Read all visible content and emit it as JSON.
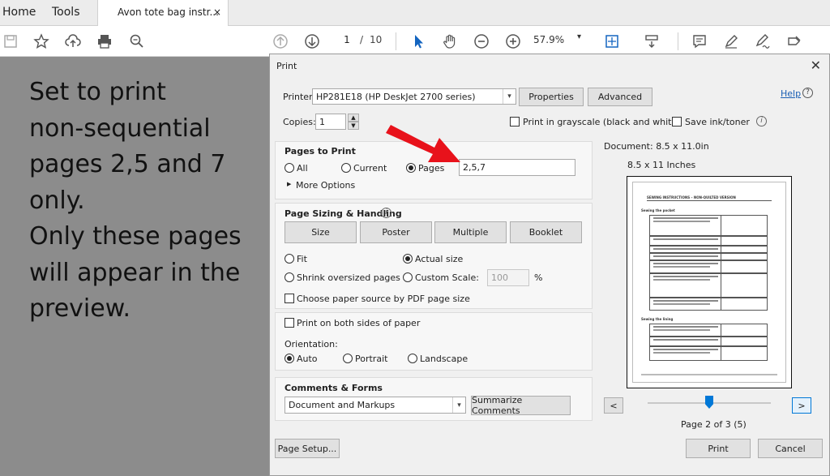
{
  "tabbar": {
    "home": "Home",
    "tools": "Tools",
    "tab_title": "Avon tote bag instr...",
    "tab_close": "×"
  },
  "toolbar": {
    "page_current": "1",
    "page_sep": "/",
    "page_total": "10",
    "zoom": "57.9%",
    "zoom_caret": "▾"
  },
  "annotation": {
    "lines": [
      "Set to print",
      "non-sequential",
      "pages 2,5 and 7",
      "only.",
      "Only these pages",
      "will appear in the",
      "preview."
    ]
  },
  "dialog": {
    "title": "Print",
    "close": "✕",
    "printer_label": "Printer:",
    "printer_value": "HP281E18 (HP DeskJet 2700 series)",
    "properties": "Properties",
    "advanced": "Advanced",
    "help": "Help",
    "help_q": "?",
    "copies_label": "Copies:",
    "copies_value": "1",
    "grayscale": "Print in grayscale (black and white)",
    "save_ink": "Save ink/toner",
    "info_i": "i",
    "pages": {
      "title": "Pages to Print",
      "all": "All",
      "current": "Current",
      "pages": "Pages",
      "pages_value": "2,5,7",
      "more_options": "More Options",
      "more_caret": "▶"
    },
    "sizing": {
      "title": "Page Sizing & Handling",
      "size": "Size",
      "poster": "Poster",
      "multiple": "Multiple",
      "booklet": "Booklet",
      "fit": "Fit",
      "actual_size": "Actual size",
      "shrink": "Shrink oversized pages",
      "custom_scale": "Custom Scale:",
      "scale_value": "100",
      "percent": "%",
      "choose_source": "Choose paper source by PDF page size"
    },
    "duplex": {
      "both_sides": "Print on both sides of paper",
      "orientation": "Orientation:",
      "auto": "Auto",
      "portrait": "Portrait",
      "landscape": "Landscape"
    },
    "comments": {
      "title": "Comments & Forms",
      "value": "Document and Markups",
      "summarize": "Summarize Comments"
    },
    "preview": {
      "document_size": "Document: 8.5 x 11.0in",
      "paper_size": "8.5 x 11 Inches",
      "prev": "<",
      "next": ">",
      "page_status": "Page 2 of 3 (5)",
      "doc_heading": "SEWING INSTRUCTIONS – NON-QUILTED VERSION",
      "doc_section1": "Sewing the pocket",
      "doc_section2": "Sewing the lining"
    },
    "page_setup": "Page Setup...",
    "print": "Print",
    "cancel": "Cancel"
  },
  "colors": {
    "accent": "#0078d7",
    "arrow": "#e8121b",
    "link": "#1a5fb4"
  }
}
